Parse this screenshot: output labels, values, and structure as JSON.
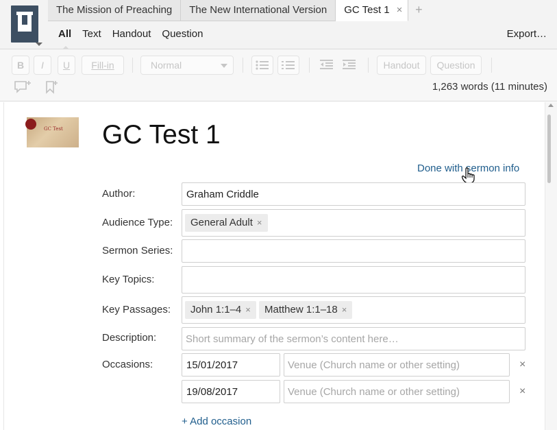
{
  "tabs": [
    {
      "label": "The Mission of Preaching"
    },
    {
      "label": "The New International Version"
    },
    {
      "label": "GC Test 1",
      "active": true,
      "close": "×"
    }
  ],
  "new_tab": "+",
  "subnav": [
    "All",
    "Text",
    "Handout",
    "Question"
  ],
  "export_label": "Export…",
  "toolbar": {
    "bold": "B",
    "italic": "I",
    "underline": "U",
    "fill_in": "Fill-in",
    "style_select": "Normal",
    "handout": "Handout",
    "question": "Question",
    "word_count": "1,263 words (11 minutes)"
  },
  "thumbnail_text": "GC Test",
  "document": {
    "title": "GC Test 1",
    "done_link": "Done with sermon info"
  },
  "form": {
    "author_label": "Author:",
    "author_value": "Graham Criddle",
    "audience_label": "Audience Type:",
    "audience_chips": [
      "General Adult"
    ],
    "series_label": "Sermon Series:",
    "topics_label": "Key Topics:",
    "passages_label": "Key Passages:",
    "passage_chips": [
      "John 1:1–4",
      "Matthew 1:1–18"
    ],
    "description_label": "Description:",
    "description_placeholder": "Short summary of the sermon’s content here…",
    "occasions_label": "Occasions:",
    "occasions": [
      {
        "date": "15/01/2017",
        "venue_placeholder": "Venue (Church name or other setting)"
      },
      {
        "date": "19/08/2017",
        "venue_placeholder": "Venue (Church name or other setting)"
      }
    ],
    "remove_glyph": "×",
    "chip_remove_glyph": "×",
    "add_occasion": "+ Add occasion"
  },
  "colors": {
    "logo": "#3d4f62",
    "link": "#1f5d8c"
  }
}
